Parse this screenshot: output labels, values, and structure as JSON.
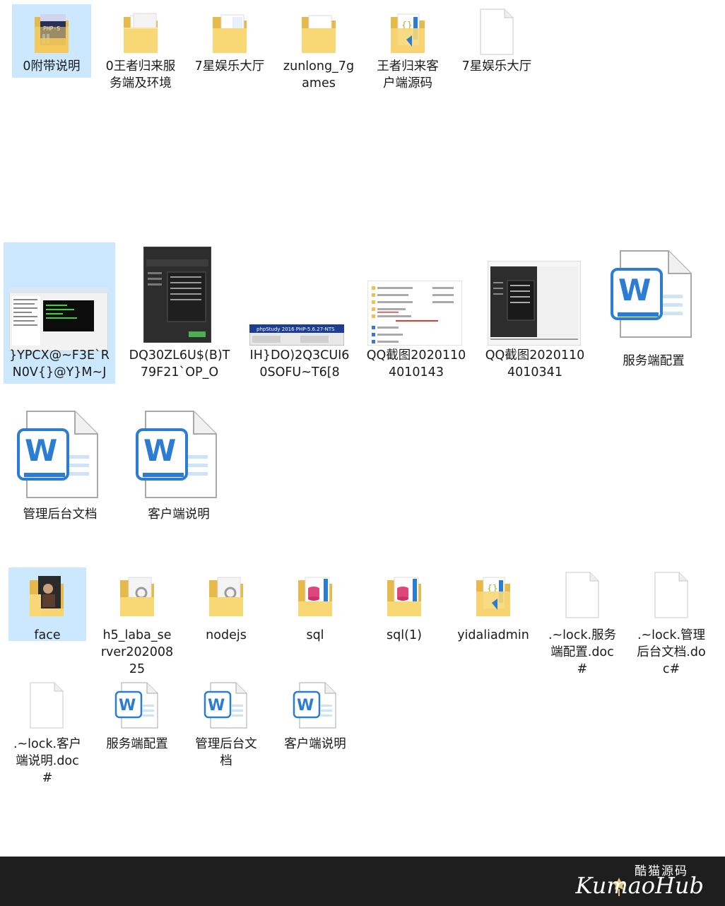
{
  "folders_top": [
    {
      "label": "0附带说明",
      "icon": "folder-php-icon"
    },
    {
      "label": "0王者归来服务端及环境",
      "icon": "folder-icon"
    },
    {
      "label": "7星娱乐大厅",
      "icon": "folder-icon"
    },
    {
      "label": "zunlong_7games",
      "icon": "folder-icon"
    },
    {
      "label": "王者归来客户端源码",
      "icon": "folder-vscode-icon"
    },
    {
      "label": "7星娱乐大厅",
      "icon": "blank-file-icon"
    }
  ],
  "images_files": [
    {
      "label": "}YPCX@~F3E`RN0V{}@Y}M~J",
      "icon": "screenshot-thumbnail-icon"
    },
    {
      "label": "DQ30ZL6U$(B)T79F21`OP_O",
      "icon": "screenshot-thumbnail-icon"
    },
    {
      "label": "IH}DO)2Q3CUI60SOFU~T6[8",
      "icon": "screenshot-thumbnail-icon"
    },
    {
      "label": "QQ截图20201104010143",
      "icon": "screenshot-thumbnail-icon"
    },
    {
      "label": "QQ截图20201104010341",
      "icon": "screenshot-thumbnail-icon"
    },
    {
      "label": "服务端配置",
      "icon": "word-doc-icon"
    },
    {
      "label": "管理后台文档",
      "icon": "word-doc-icon"
    },
    {
      "label": "客户端说明",
      "icon": "word-doc-icon"
    }
  ],
  "folders_bottom": [
    {
      "label": "face",
      "icon": "folder-image-icon"
    },
    {
      "label": "h5_laba_server20200825",
      "icon": "folder-gear-icon"
    },
    {
      "label": "nodejs",
      "icon": "folder-gear-icon"
    },
    {
      "label": "sql",
      "icon": "folder-database-icon"
    },
    {
      "label": "sql(1)",
      "icon": "folder-database-icon"
    },
    {
      "label": "yidaliadmin",
      "icon": "folder-vscode-icon"
    },
    {
      "label": ".~lock.服务端配置.doc#",
      "icon": "blank-file-icon"
    },
    {
      "label": ".~lock.管理后台文档.doc#",
      "icon": "blank-file-icon"
    },
    {
      "label": ".~lock.客户端说明.doc#",
      "icon": "blank-file-icon"
    },
    {
      "label": "服务端配置",
      "icon": "word-doc-icon"
    },
    {
      "label": "管理后台文档",
      "icon": "word-doc-icon"
    },
    {
      "label": "客户端说明",
      "icon": "word-doc-icon"
    }
  ],
  "watermark": {
    "chinese": "酷猫源码",
    "english": "KumaoHub"
  },
  "colors": {
    "selection": "#cce8ff",
    "folder": "#f8d775",
    "word_blue": "#2b7cd3",
    "footer": "#1e1e1e"
  }
}
